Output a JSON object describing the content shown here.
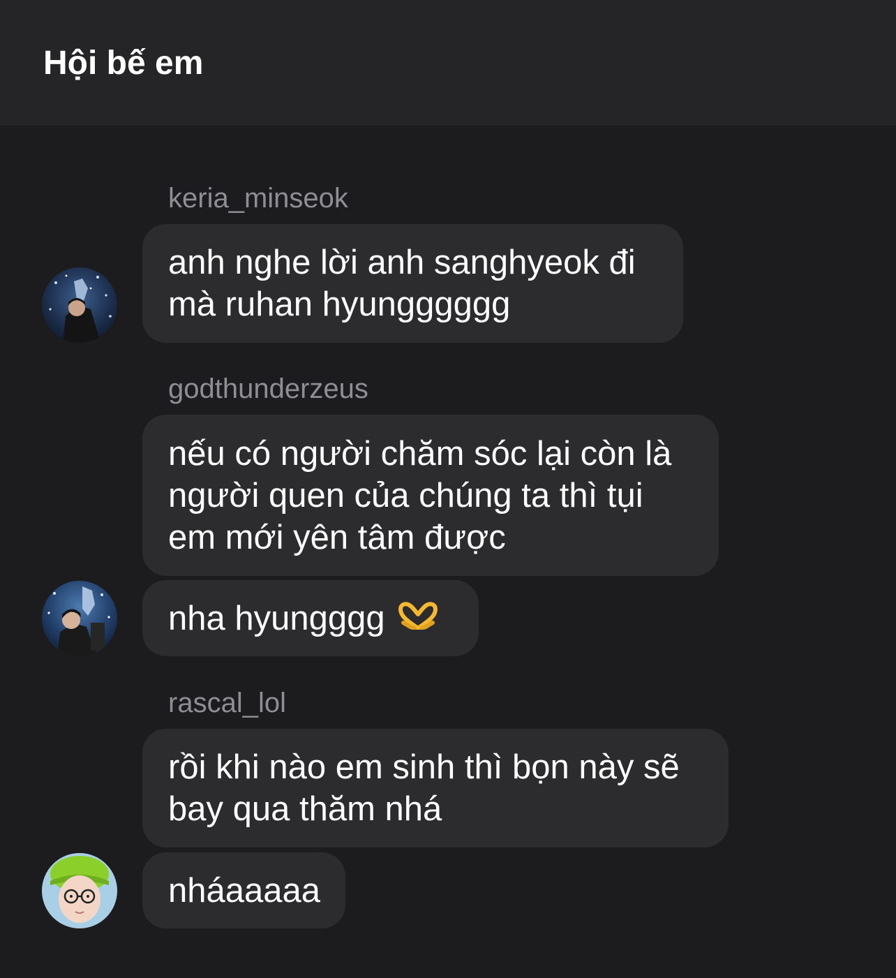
{
  "header": {
    "title": "Hội bế em"
  },
  "messages": [
    {
      "sender": "keria_minseok",
      "bubbles": [
        {
          "text": "anh nghe lời anh sanghyeok đi\nmà ruhan hyungggggg"
        }
      ]
    },
    {
      "sender": "godthunderzeus",
      "bubbles": [
        {
          "text": "nếu có người chăm sóc lại còn là\nngười quen của chúng ta thì tụi\nem mới yên tâm được"
        },
        {
          "text": "nha hyungggg",
          "emoji": "heart-hands-emoji"
        }
      ]
    },
    {
      "sender": "rascal_lol",
      "bubbles": [
        {
          "text": "rồi khi nào em sinh thì bọn này sẽ\nbay qua thăm nhá"
        },
        {
          "text": "nháaaaaa"
        }
      ]
    }
  ],
  "colors": {
    "background": "#1c1c1e",
    "header": "#252527",
    "bubble": "#2c2c2e",
    "sender_name": "#8e8e93",
    "text": "#ffffff"
  }
}
